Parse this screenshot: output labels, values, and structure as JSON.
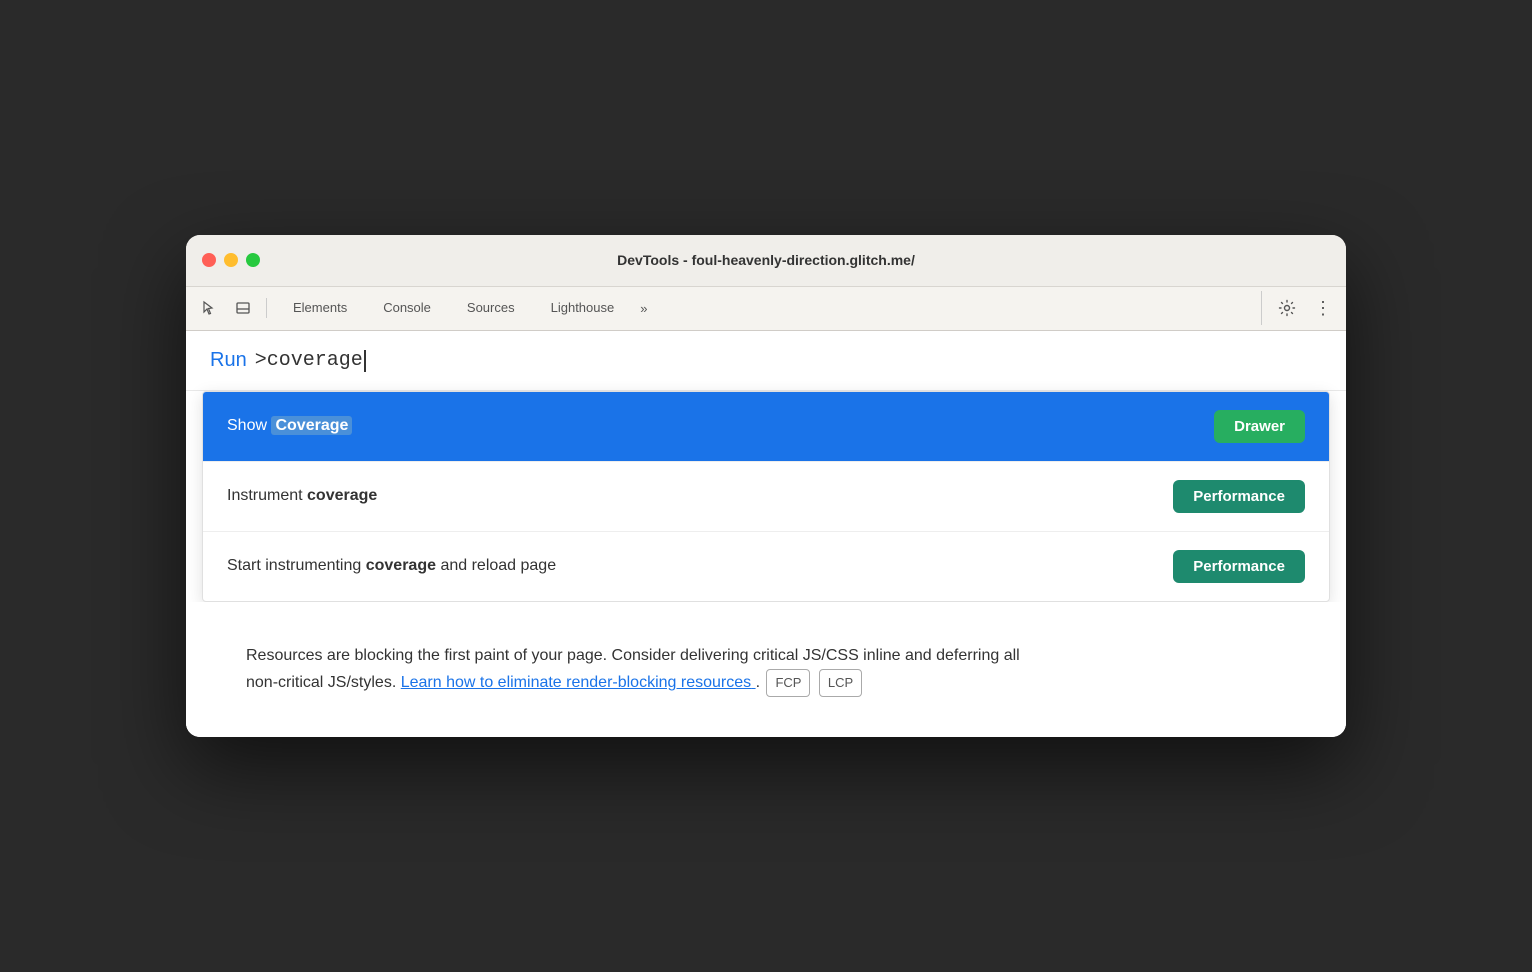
{
  "titlebar": {
    "title": "DevTools - foul-heavenly-direction.glitch.me/"
  },
  "toolbar": {
    "tabs": [
      {
        "id": "elements",
        "label": "Elements"
      },
      {
        "id": "console",
        "label": "Console"
      },
      {
        "id": "sources",
        "label": "Sources"
      },
      {
        "id": "lighthouse",
        "label": "Lighthouse"
      }
    ],
    "more_label": "»",
    "settings_label": "⚙",
    "more_options_label": "⋮"
  },
  "command": {
    "run_label": "Run",
    "input_text": ">coverage"
  },
  "dropdown": {
    "items": [
      {
        "id": "show-coverage",
        "text_plain": "Show ",
        "text_bold": "Coverage",
        "badge_label": "Drawer",
        "badge_type": "drawer",
        "active": true
      },
      {
        "id": "instrument-coverage",
        "text_plain": "Instrument ",
        "text_bold": "coverage",
        "badge_label": "Performance",
        "badge_type": "performance",
        "active": false
      },
      {
        "id": "start-instrumenting",
        "text_plain": "Start instrumenting ",
        "text_bold": "coverage",
        "text_suffix": " and reload page",
        "badge_label": "Performance",
        "badge_type": "performance",
        "active": false
      }
    ]
  },
  "page": {
    "description_text": "Resources are blocking the first paint of your page. Consider delivering critical JS/CSS inline and deferring all non-critical JS/styles.",
    "link_text": "Learn how to eliminate render-blocking resources",
    "link_href": "#",
    "tags": [
      "FCP",
      "LCP"
    ]
  },
  "icons": {
    "cursor": "⬚",
    "window": "⬜"
  }
}
